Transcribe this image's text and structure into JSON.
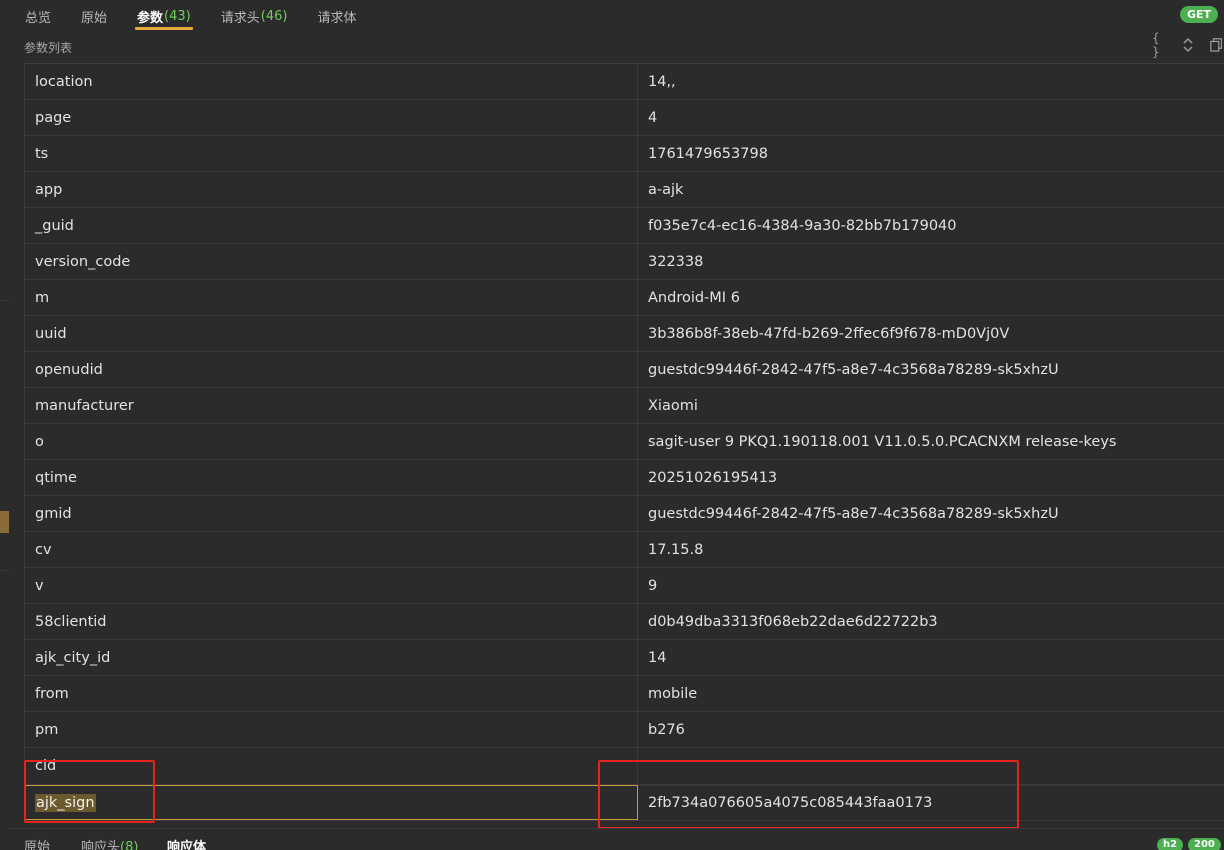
{
  "tabs": [
    {
      "label": "总览",
      "count": ""
    },
    {
      "label": "原始",
      "count": ""
    },
    {
      "label": "参数",
      "count": "(43)"
    },
    {
      "label": "请求头",
      "count": "(46)"
    },
    {
      "label": "请求体",
      "count": ""
    }
  ],
  "method": "GET",
  "section": {
    "title": "参数列表",
    "icons": [
      "braces-icon",
      "expand-collapse-icon",
      "copy-icon"
    ]
  },
  "params": [
    {
      "key": "location",
      "value": "14,,"
    },
    {
      "key": "page",
      "value": "4"
    },
    {
      "key": "ts",
      "value": "1761479653798"
    },
    {
      "key": "app",
      "value": "a-ajk"
    },
    {
      "key": "_guid",
      "value": "f035e7c4-ec16-4384-9a30-82bb7b179040"
    },
    {
      "key": "version_code",
      "value": "322338"
    },
    {
      "key": "m",
      "value": "Android-MI 6"
    },
    {
      "key": "uuid",
      "value": "3b386b8f-38eb-47fd-b269-2ffec6f9f678-mD0Vj0V"
    },
    {
      "key": "openudid",
      "value": "guestdc99446f-2842-47f5-a8e7-4c3568a78289-sk5xhzU"
    },
    {
      "key": "manufacturer",
      "value": "Xiaomi"
    },
    {
      "key": "o",
      "value": "sagit-user 9 PKQ1.190118.001 V11.0.5.0.PCACNXM release-keys"
    },
    {
      "key": "qtime",
      "value": "20251026195413"
    },
    {
      "key": "gmid",
      "value": "guestdc99446f-2842-47f5-a8e7-4c3568a78289-sk5xhzU"
    },
    {
      "key": "cv",
      "value": "17.15.8"
    },
    {
      "key": "v",
      "value": "9"
    },
    {
      "key": "58clientid",
      "value": "d0b49dba3313f068eb22dae6d22722b3"
    },
    {
      "key": "ajk_city_id",
      "value": "14"
    },
    {
      "key": "from",
      "value": "mobile"
    },
    {
      "key": "pm",
      "value": "b276"
    },
    {
      "key": "cid",
      "value": ""
    },
    {
      "key": "ajk_sign",
      "value": "2fb734a076605a4075c085443faa0173"
    }
  ],
  "bottom_tabs": [
    {
      "label": "原始",
      "count": ""
    },
    {
      "label": "响应头",
      "count": "(8)"
    },
    {
      "label": "响应体",
      "count": ""
    }
  ],
  "bottom_badges": [
    "h2",
    "200"
  ],
  "colors": {
    "accent": "#e6a93b",
    "count": "#6fcf5a",
    "badge": "#4caf50",
    "annotation": "#e8231c"
  }
}
